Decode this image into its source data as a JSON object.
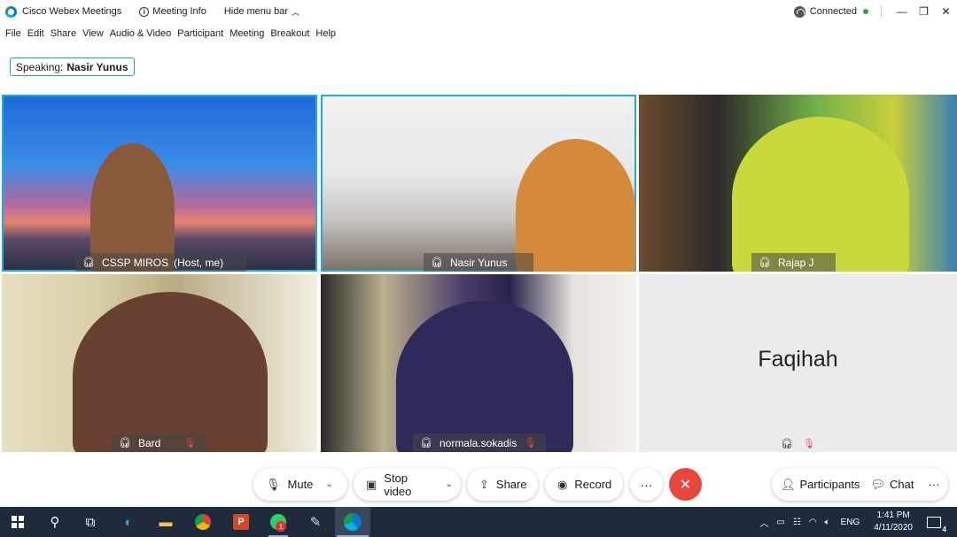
{
  "window": {
    "app_title": "Cisco Webex Meetings",
    "meeting_info": "Meeting Info",
    "hide_menu_bar": "Hide menu bar",
    "status": "Connected",
    "status_color": "#27a844"
  },
  "menu": [
    "File",
    "Edit",
    "Share",
    "View",
    "Audio & Video",
    "Participant",
    "Meeting",
    "Breakout",
    "Help"
  ],
  "speaking": {
    "label": "Speaking:",
    "name": "Nasir Yunus"
  },
  "participants": [
    {
      "name": "CSSP MIROS",
      "suffix": "(Host, me)",
      "active": true
    },
    {
      "name": "Nasir Yunus",
      "active": true
    },
    {
      "name": "Rajap J"
    },
    {
      "name": "Bard",
      "muted": true
    },
    {
      "name": "normala.sokadis",
      "muted": true
    },
    {
      "name": "Faqihah",
      "muted": true,
      "video_off": true
    }
  ],
  "controls": {
    "mute": "Mute",
    "stop_video": "Stop video",
    "share": "Share",
    "record": "Record",
    "more": "···",
    "participants": "Participants",
    "chat": "Chat",
    "end_color": "#e8483c"
  },
  "taskbar": {
    "language": "ENG",
    "time": "1:41 PM",
    "date": "4/11/2020",
    "whatsapp_badge": "1",
    "notifications": "4"
  }
}
